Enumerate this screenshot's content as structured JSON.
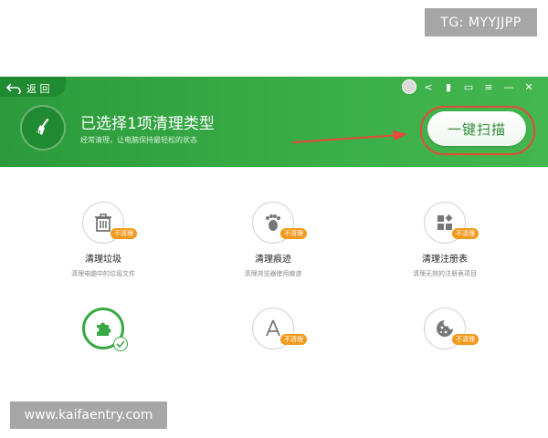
{
  "watermarks": {
    "top": "TG: MYYJJPP",
    "bottom": "www.kaifaentry.com"
  },
  "titlebar": {
    "back_label": "返 回"
  },
  "header": {
    "headline": "已选择1项清理类型",
    "subline": "经常清理，让电脑保持最轻松的状态",
    "scan_button": "一键扫描"
  },
  "items": [
    {
      "label": "清理垃圾",
      "desc": "清理电脑中的垃圾文件",
      "badge": "不清理",
      "icon": "trash-icon"
    },
    {
      "label": "清理痕迹",
      "desc": "清理浏览器使用痕迹",
      "badge": "不清理",
      "icon": "footprint-icon"
    },
    {
      "label": "清理注册表",
      "desc": "清理无效的注册表项目",
      "badge": "不清理",
      "icon": "registry-blocks-icon"
    },
    {
      "badge": "",
      "icon": "puzzle-plugin-icon",
      "selected": true
    },
    {
      "badge": "不清理",
      "icon": "app-store-icon"
    },
    {
      "badge": "不清理",
      "icon": "cookie-icon"
    }
  ],
  "colors": {
    "brand_green": "#38a844",
    "badge_orange": "#f39a1e",
    "highlight_red": "#e84a3a"
  }
}
